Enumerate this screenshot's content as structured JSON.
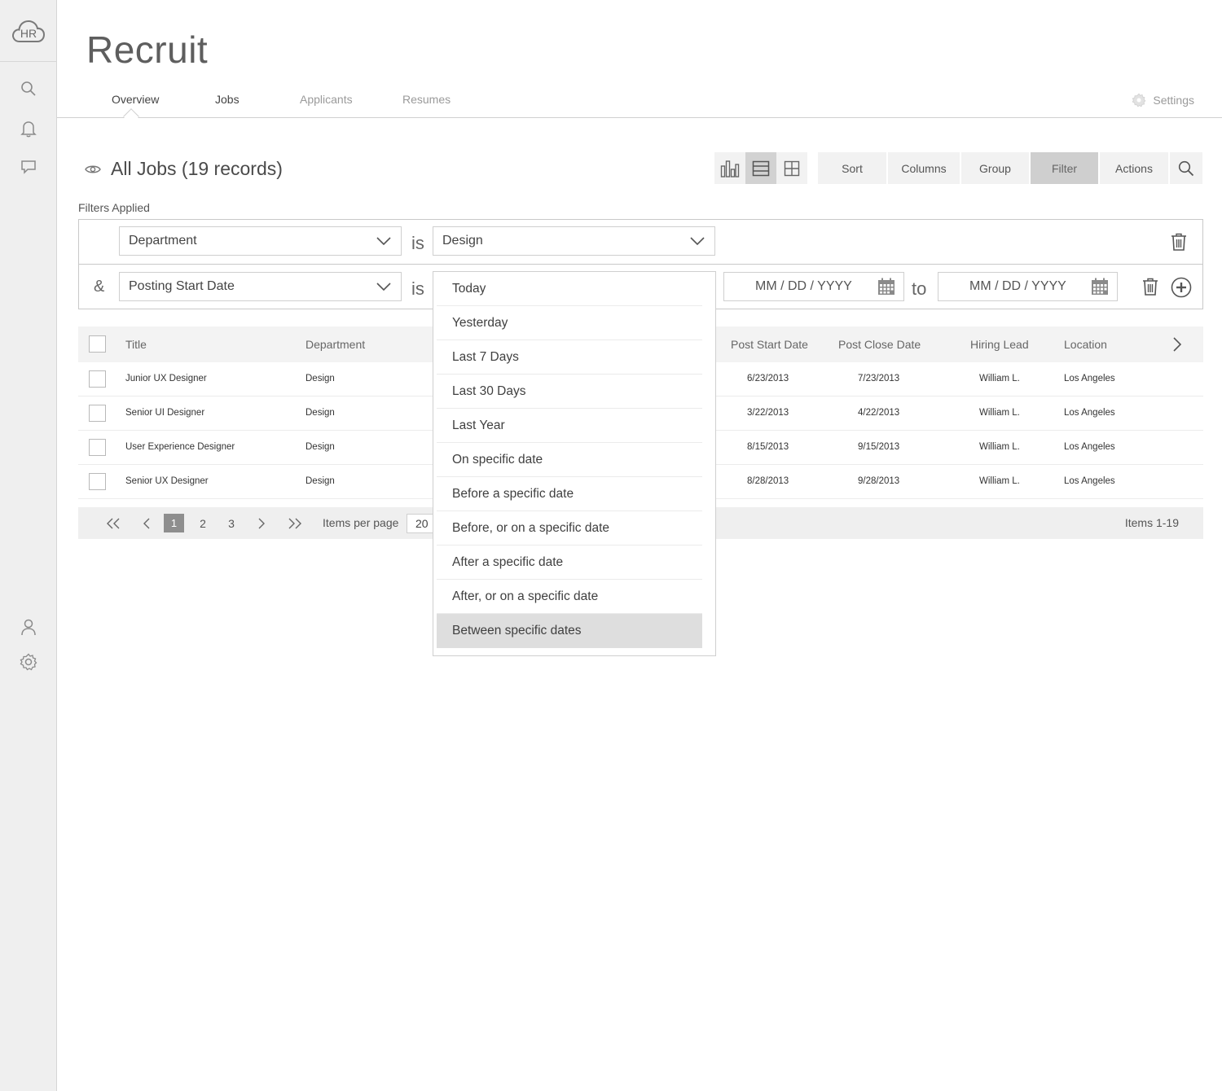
{
  "app": {
    "logo_text": "HR",
    "title": "Recruit"
  },
  "tabs": [
    {
      "label": "Overview",
      "active": true
    },
    {
      "label": "Jobs",
      "active": false
    },
    {
      "label": "Applicants",
      "active": false
    },
    {
      "label": "Resumes",
      "active": false
    }
  ],
  "settings_label": "Settings",
  "list": {
    "title": "All Jobs (19 records)"
  },
  "toolbar": {
    "sort": "Sort",
    "columns": "Columns",
    "group": "Group",
    "filter": "Filter",
    "actions": "Actions"
  },
  "filters": {
    "label": "Filters Applied",
    "row1": {
      "field": "Department",
      "operator": "is",
      "value": "Design"
    },
    "row2": {
      "conjunction": "&",
      "field": "Posting Start Date",
      "operator": "is",
      "from_placeholder": "MM / DD / YYYY",
      "to_label": "to",
      "to_placeholder": "MM / DD / YYYY"
    }
  },
  "table": {
    "headers": {
      "title": "Title",
      "department": "Department",
      "post_start": "Post Start Date",
      "post_close": "Post Close Date",
      "hiring_lead": "Hiring Lead",
      "location": "Location"
    },
    "rows": [
      {
        "title": "Junior UX Designer",
        "department": "Design",
        "post_start": "6/23/2013",
        "post_close": "7/23/2013",
        "hiring_lead": "William L.",
        "location": "Los Angeles"
      },
      {
        "title": "Senior UI Designer",
        "department": "Design",
        "post_start": "3/22/2013",
        "post_close": "4/22/2013",
        "hiring_lead": "William L.",
        "location": "Los Angeles"
      },
      {
        "title": "User Experience Designer",
        "department": "Design",
        "post_start": "8/15/2013",
        "post_close": "9/15/2013",
        "hiring_lead": "William L.",
        "location": "Los Angeles"
      },
      {
        "title": "Senior UX Designer",
        "department": "Design",
        "post_start": "8/28/2013",
        "post_close": "9/28/2013",
        "hiring_lead": "William L.",
        "location": "Los Angeles"
      }
    ]
  },
  "pager": {
    "pages": [
      "1",
      "2",
      "3"
    ],
    "current_page": "1",
    "items_per_page_label": "Items per page",
    "items_per_page_value": "20",
    "items_range": "Items 1-19"
  },
  "date_options": [
    "Today",
    "Yesterday",
    "Last 7 Days",
    "Last 30 Days",
    "Last Year",
    "On specific date",
    "Before a specific date",
    "Before, or on a specific date",
    "After a specific date",
    "After, or on a specific date",
    "Between specific dates"
  ],
  "selected_date_option": "Between specific dates",
  "colors": {
    "sidebar_bg": "#efefef",
    "toolbar_bg": "#f2f2f2",
    "active_filter_bg": "#cfcfcf",
    "current_page_bg": "#8e8e8e",
    "selected_option_bg": "#dedede"
  }
}
